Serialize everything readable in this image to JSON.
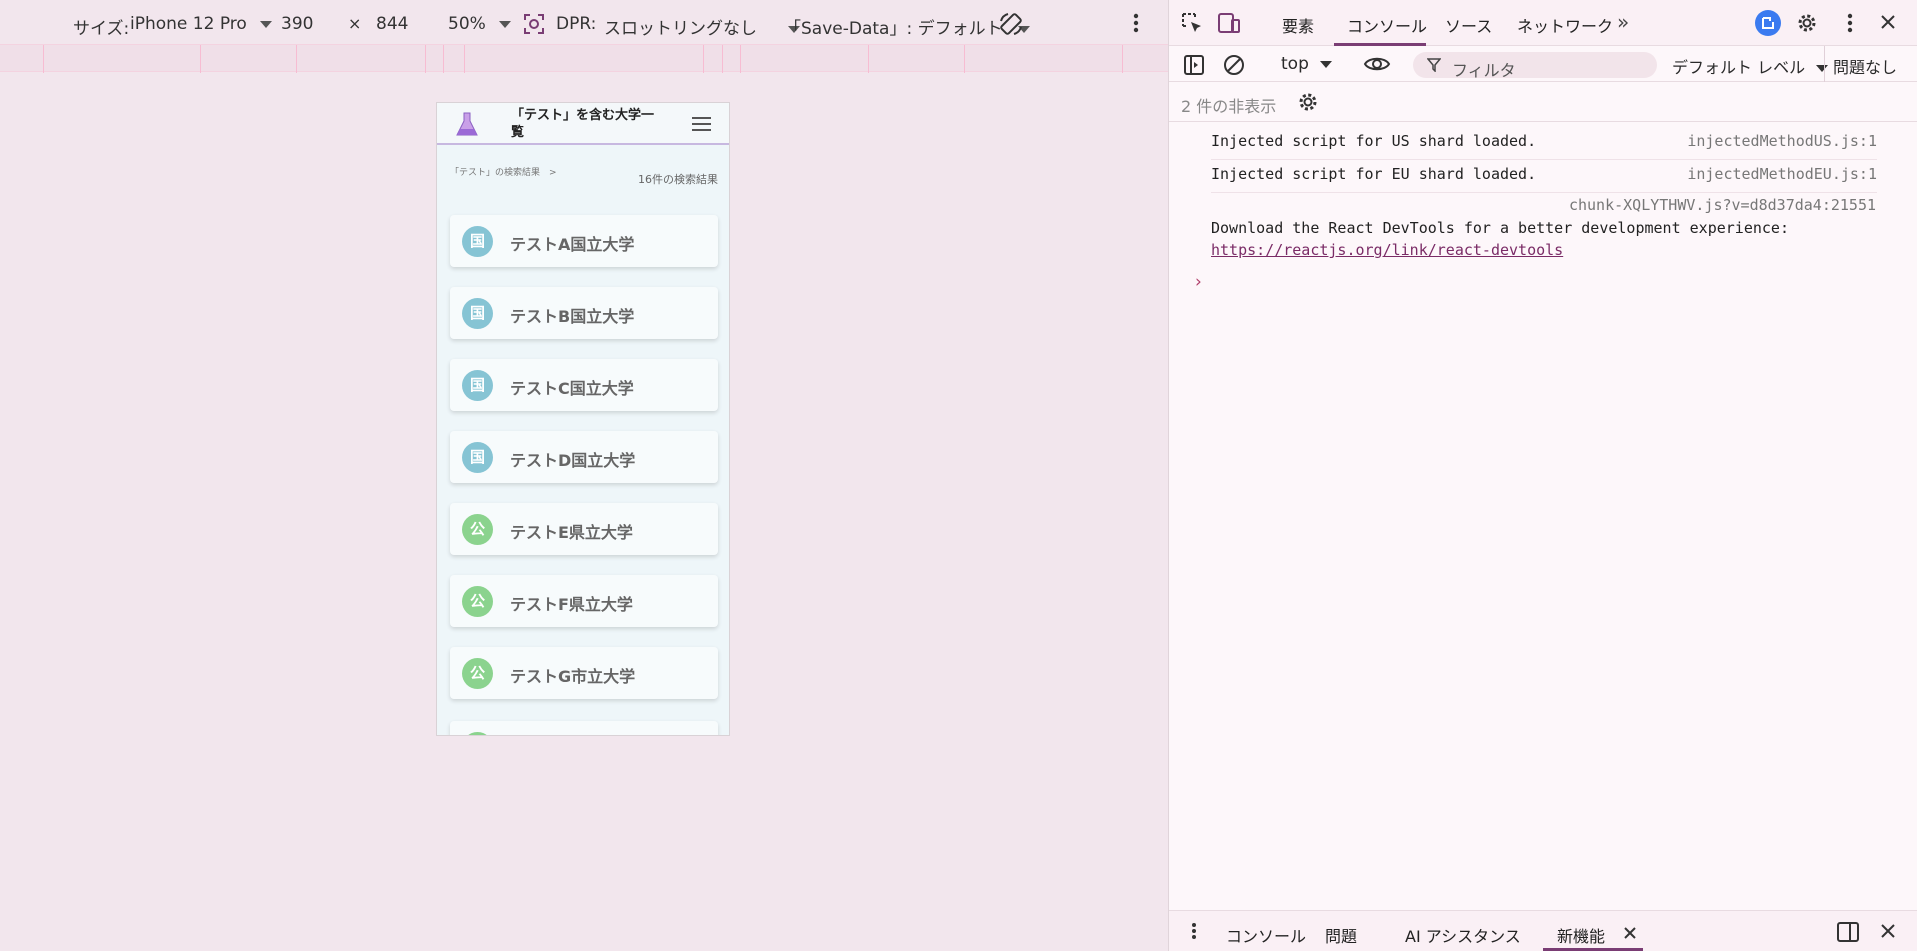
{
  "device_toolbar": {
    "size_label": "サイズ:",
    "device_name": "iPhone 12 Pro",
    "width": "390",
    "times": "×",
    "height": "844",
    "zoom": "50%",
    "dpr_label": "DPR:",
    "throttle": "スロットリングなし",
    "save_data": "「Save-Data」: デフォルト"
  },
  "phone": {
    "title": "「テスト」を含む大学一覧",
    "breadcrumb": "「テスト」の検索結果　>",
    "result_count": "16件の検索結果",
    "universities": [
      {
        "badge": "国",
        "name": "テストA国立大学",
        "color": "#86c4d4"
      },
      {
        "badge": "国",
        "name": "テストB国立大学",
        "color": "#86c4d4"
      },
      {
        "badge": "国",
        "name": "テストC国立大学",
        "color": "#86c4d4"
      },
      {
        "badge": "国",
        "name": "テストD国立大学",
        "color": "#86c4d4"
      },
      {
        "badge": "公",
        "name": "テストE県立大学",
        "color": "#8bd38e"
      },
      {
        "badge": "公",
        "name": "テストF県立大学",
        "color": "#8bd38e"
      },
      {
        "badge": "公",
        "name": "テストG市立大学",
        "color": "#8bd38e"
      }
    ]
  },
  "devtools": {
    "tabs": {
      "elements": "要素",
      "console": "コンソール",
      "sources": "ソース",
      "network": "ネットワーク"
    },
    "context": "top",
    "filter_placeholder": "フィルタ",
    "level": "デフォルト レベル",
    "issues": "問題なし",
    "hidden_count": "2 件の非表示",
    "logs": [
      {
        "text": "Injected script for US shard loaded.",
        "source": "injectedMethodUS.js:1"
      },
      {
        "text": "Injected script for EU shard loaded.",
        "source": "injectedMethodEU.js:1"
      }
    ],
    "react_source": "chunk-XQLYTHWV.js?v=d8d37da4:21551",
    "react_message": "Download the React DevTools for a better development experience:",
    "react_link": "https://reactjs.org/link/react-devtools",
    "bottom_tabs": {
      "console": "コンソール",
      "issues": "問題",
      "ai": "AI アシスタンス",
      "whats_new": "新機能"
    }
  }
}
